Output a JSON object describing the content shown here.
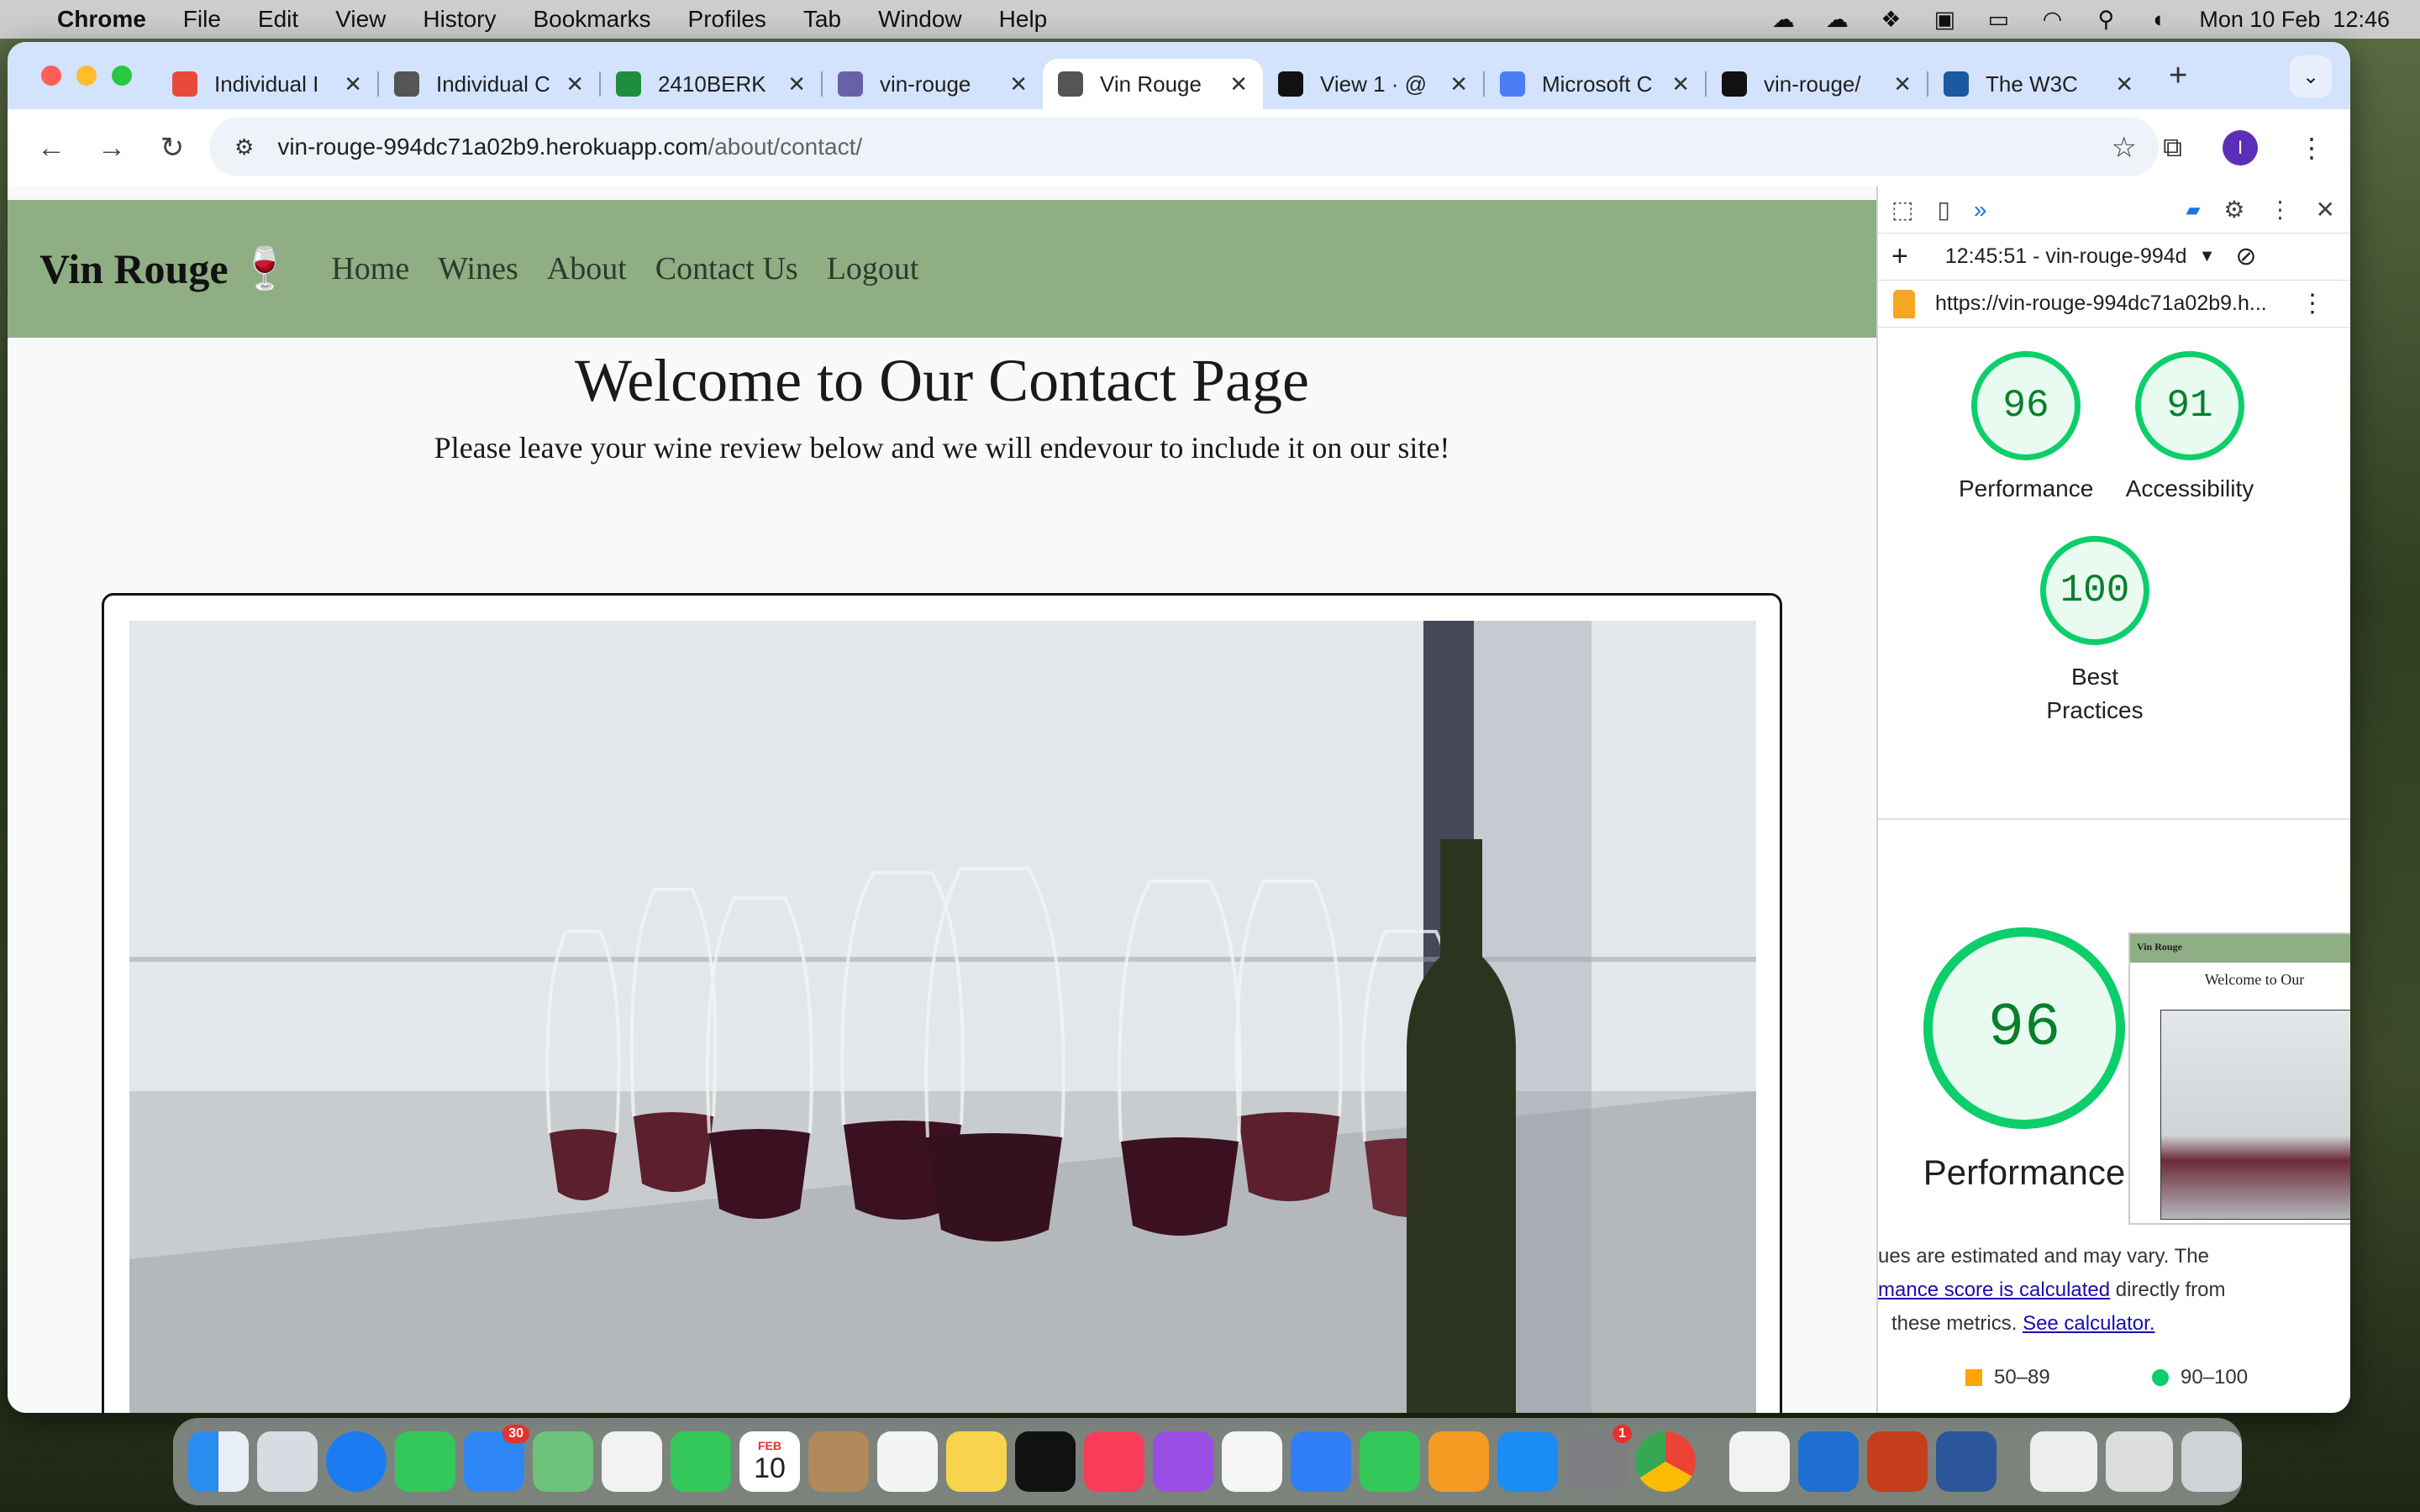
{
  "menubar": {
    "app": "Chrome",
    "items": [
      "File",
      "Edit",
      "View",
      "History",
      "Bookmarks",
      "Profiles",
      "Tab",
      "Window",
      "Help"
    ],
    "datetime": "Mon 10 Feb  12:46"
  },
  "browser": {
    "tabs": [
      {
        "title": "Individual I",
        "favicon": "opera-icon",
        "color": "#e8493b"
      },
      {
        "title": "Individual C",
        "favicon": "globe-icon",
        "color": "#555555"
      },
      {
        "title": "2410BERK",
        "favicon": "sheets-icon",
        "color": "#1e8e3e"
      },
      {
        "title": "vin-rouge",
        "favicon": "heroku-icon",
        "color": "#6762a6"
      },
      {
        "title": "Vin Rouge",
        "favicon": "globe-icon",
        "color": "#555555",
        "active": true
      },
      {
        "title": "View 1 · @",
        "favicon": "github-icon",
        "color": "#111111"
      },
      {
        "title": "Microsoft C",
        "favicon": "copilot-icon",
        "color": "#4a7cf5"
      },
      {
        "title": "vin-rouge/",
        "favicon": "github-icon",
        "color": "#111111"
      },
      {
        "title": "The W3C",
        "favicon": "w3c-icon",
        "color": "#1a5aa0"
      }
    ],
    "url_host": "vin-rouge-994dc71a02b9.herokuapp.com",
    "url_path": "/about/contact/",
    "avatar_letter": "I"
  },
  "site": {
    "brand": "Vin Rouge 🍷",
    "nav": [
      "Home",
      "Wines",
      "About",
      "Contact Us",
      "Logout"
    ],
    "title": "Welcome to Our Contact Page",
    "subtitle": "Please leave your wine review below and we will endevour to include it on our site!",
    "nav_color": "#8fae84"
  },
  "devtools": {
    "report_time": "12:45:51 - vin-rouge-994d",
    "report_url": "https://vin-rouge-994dc71a02b9.h...",
    "scores": [
      {
        "label": "Performance",
        "value": "96"
      },
      {
        "label": "Accessibility",
        "value": "91"
      },
      {
        "label": "Best Practices",
        "value": "100"
      }
    ],
    "big_score": {
      "label": "Performance",
      "value": "96"
    },
    "note_line1": "ues are estimated and may vary. The",
    "note_link1": "mance score is calculated",
    "note_line2": " directly from",
    "note_line3": "these metrics.",
    "note_link2": "See calculator.",
    "legend_mid": "50–89",
    "legend_high": "90–100",
    "thumb_brand": "Vin Rouge",
    "thumb_title": "Welcome to Our"
  },
  "dock": {
    "mail_badge": "30",
    "settings_badge": "1",
    "calendar_month": "FEB",
    "calendar_day": "10"
  }
}
